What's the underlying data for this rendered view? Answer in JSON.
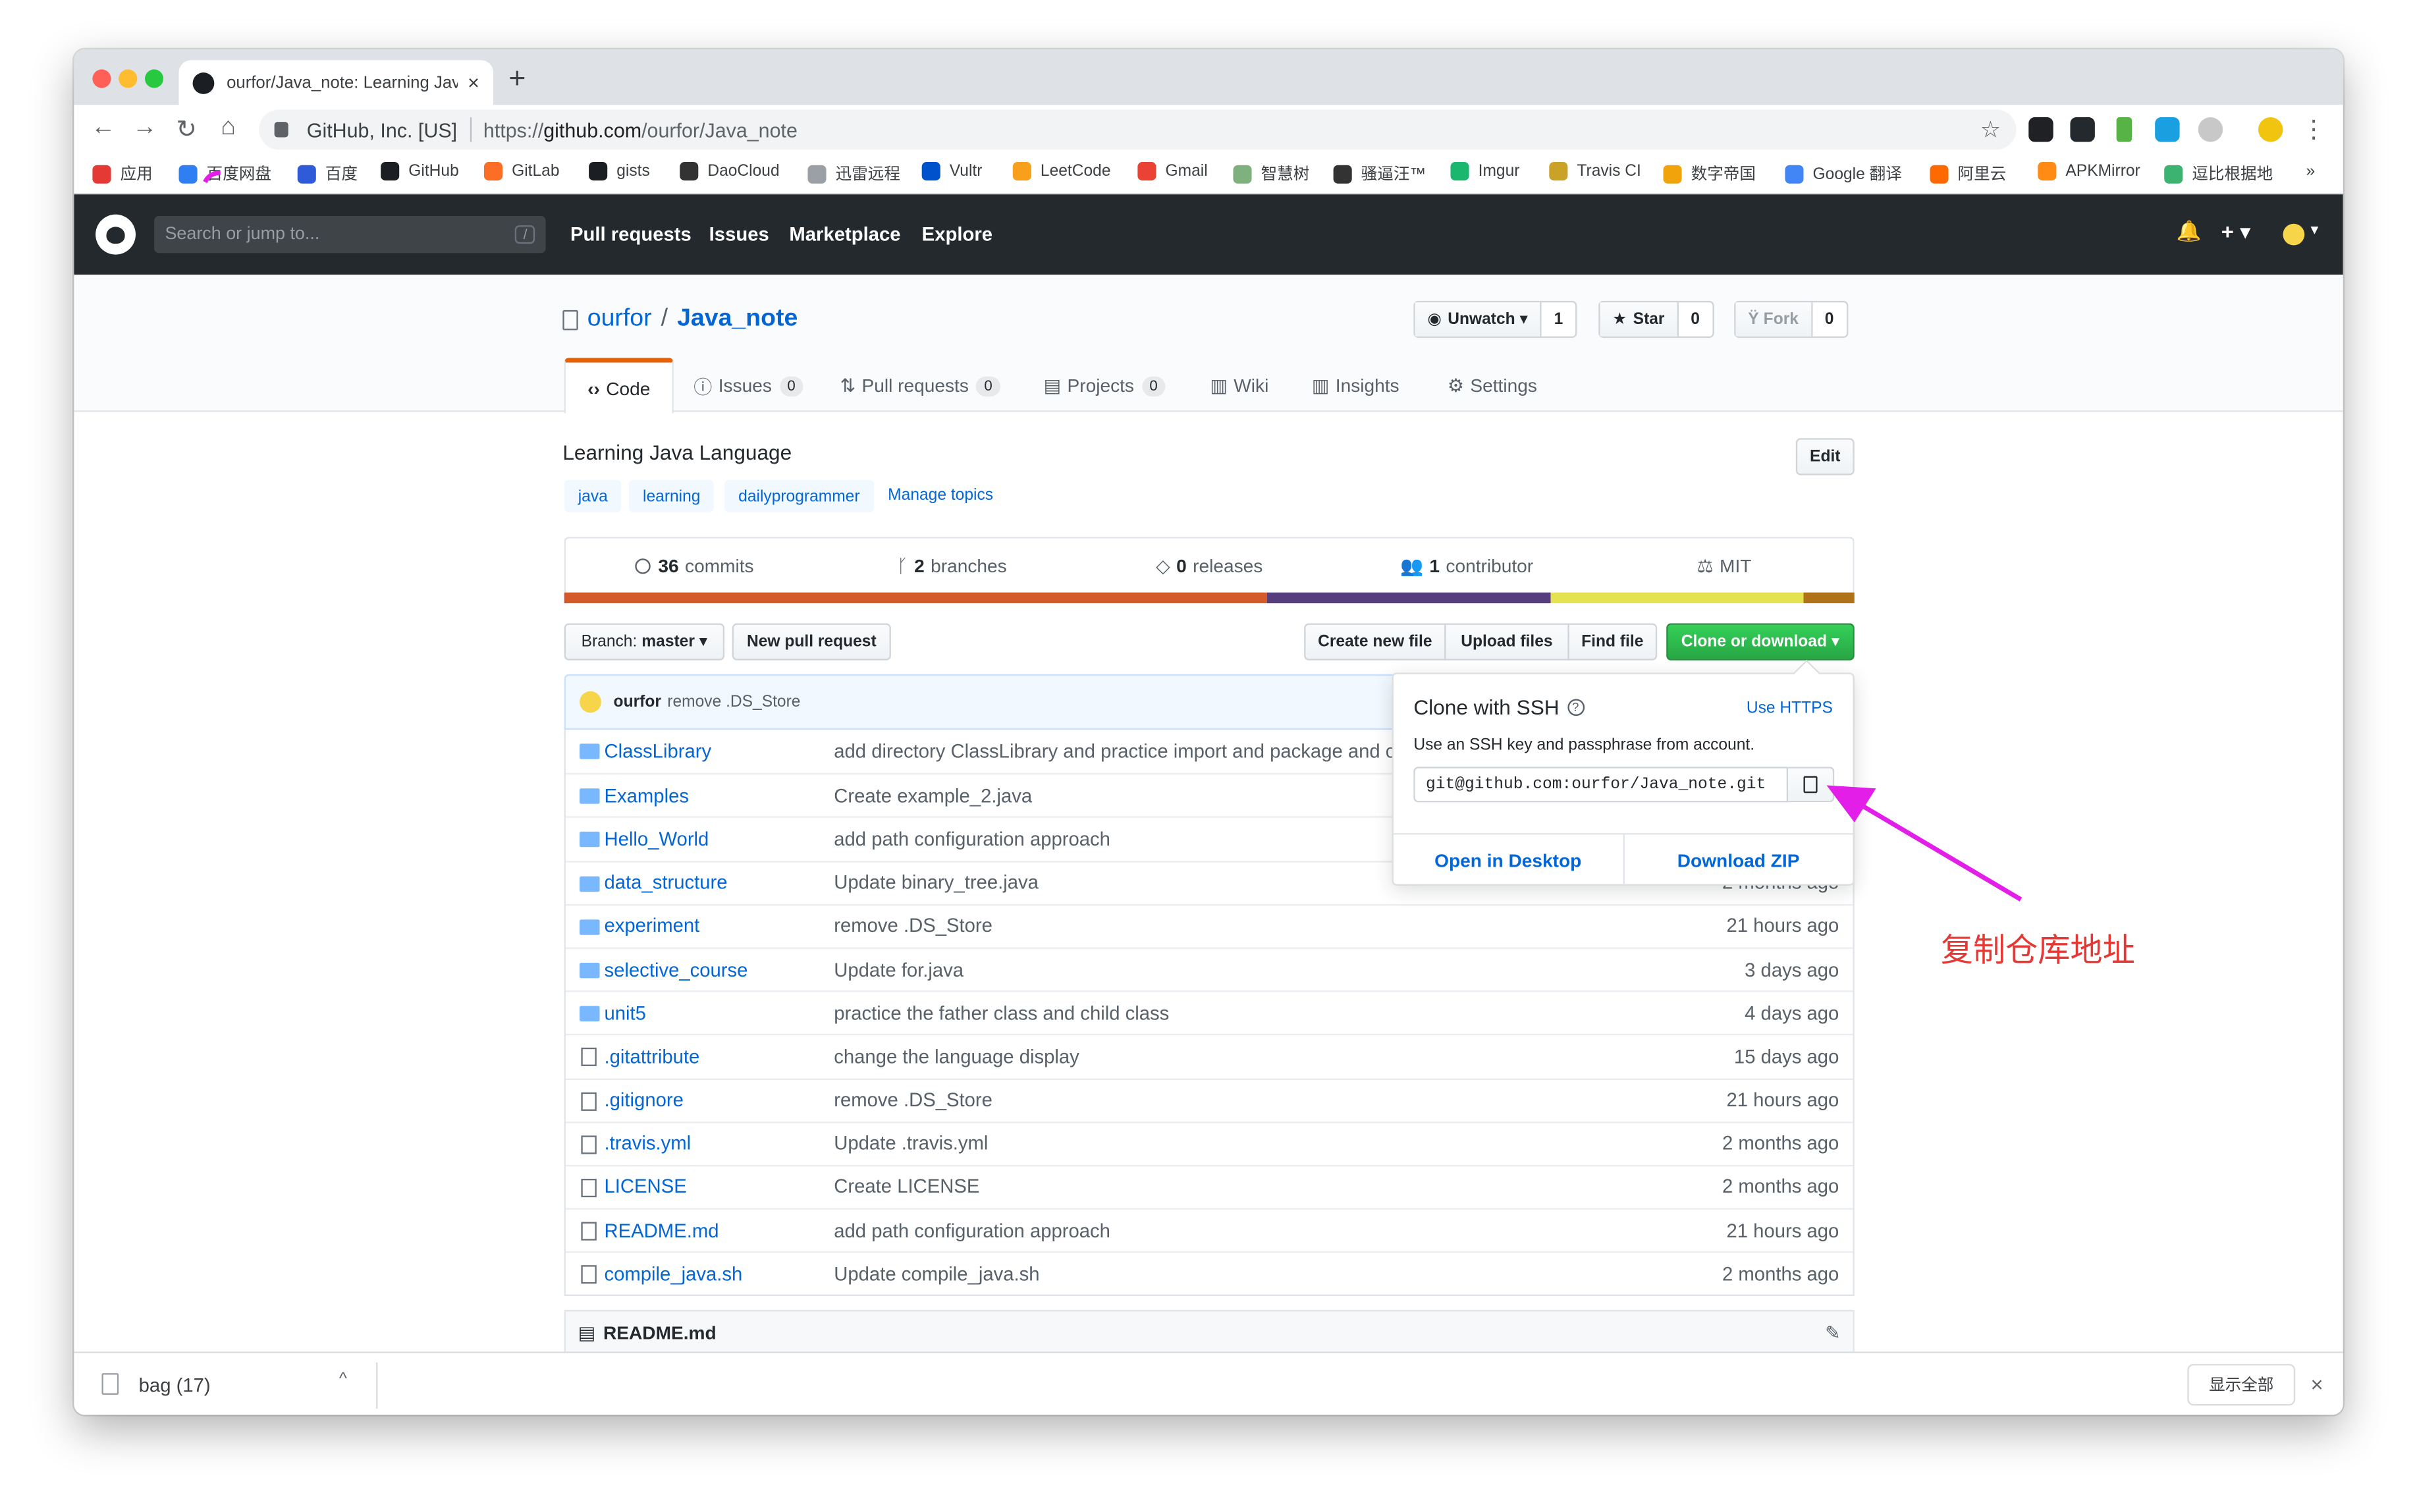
{
  "browser": {
    "tab_title": "ourfor/Java_note: Learning Jav",
    "tab_close": "×",
    "new_tab": "+",
    "url_org": "GitHub, Inc. [US]",
    "url_prefix": "https://",
    "url_host": "github.com",
    "url_path": "/ourfor/Java_note",
    "nav_back": "←",
    "nav_forward": "→",
    "nav_reload": "↻",
    "nav_home": "⌂",
    "bookmark_star": "☆",
    "menu": "⋮"
  },
  "bookmarks": [
    {
      "label": "应用",
      "icon": "apps-icon",
      "color": "#e53935"
    },
    {
      "label": "百度网盘",
      "icon": "baidu-pan-icon",
      "color": "#2f7ef2"
    },
    {
      "label": "百度",
      "icon": "baidu-icon",
      "color": "#2f5ad8"
    },
    {
      "label": "GitHub",
      "icon": "github-icon",
      "color": "#1b1f23"
    },
    {
      "label": "GitLab",
      "icon": "gitlab-icon",
      "color": "#fc6d26"
    },
    {
      "label": "gists",
      "icon": "github-icon",
      "color": "#1b1f23"
    },
    {
      "label": "DaoCloud",
      "icon": "daocloud-icon",
      "color": "#333333"
    },
    {
      "label": "迅雷远程",
      "icon": "page-icon",
      "color": "#9aa0a6"
    },
    {
      "label": "Vultr",
      "icon": "vultr-icon",
      "color": "#0052cc"
    },
    {
      "label": "LeetCode",
      "icon": "leetcode-icon",
      "color": "#f89f1b"
    },
    {
      "label": "Gmail",
      "icon": "gmail-icon",
      "color": "#ea4335"
    },
    {
      "label": "智慧树",
      "icon": "tree-icon",
      "color": "#7fb17f"
    },
    {
      "label": "骚逼汪™",
      "icon": "circle-icon",
      "color": "#333333"
    },
    {
      "label": "Imgur",
      "icon": "imgur-icon",
      "color": "#1bb76e"
    },
    {
      "label": "Travis CI",
      "icon": "travis-icon",
      "color": "#c9a227"
    },
    {
      "label": "数字帝国",
      "icon": "pi-icon",
      "color": "#f0a30a"
    },
    {
      "label": "Google 翻译",
      "icon": "translate-icon",
      "color": "#4285f4"
    },
    {
      "label": "阿里云",
      "icon": "aliyun-icon",
      "color": "#ff6a00"
    },
    {
      "label": "APKMirror",
      "icon": "apkmirror-icon",
      "color": "#ff8b14"
    },
    {
      "label": "逗比根据地",
      "icon": "leaf-icon",
      "color": "#3cb371"
    }
  ],
  "bookmarks_more": "»",
  "github": {
    "search_placeholder": "Search or jump to...",
    "search_key": "/",
    "nav": [
      "Pull requests",
      "Issues",
      "Marketplace",
      "Explore"
    ],
    "bell": "🔔",
    "plus": "+ ▾",
    "avatar_caret": "▾"
  },
  "repo": {
    "owner": "ourfor",
    "slash": "/",
    "name": "Java_note",
    "watch_label": "Unwatch ▾",
    "watch_count": "1",
    "star_label": "Star",
    "star_count": "0",
    "fork_label": "Fork",
    "fork_count": "0",
    "tabs": [
      {
        "label": "Code",
        "count": ""
      },
      {
        "label": "Issues",
        "count": "0"
      },
      {
        "label": "Pull requests",
        "count": "0"
      },
      {
        "label": "Projects",
        "count": "0"
      },
      {
        "label": "Wiki",
        "count": ""
      },
      {
        "label": "Insights",
        "count": ""
      },
      {
        "label": "Settings",
        "count": ""
      }
    ],
    "description": "Learning Java Language",
    "edit_label": "Edit",
    "topics": [
      "java",
      "learning",
      "dailyprogrammer"
    ],
    "manage_topics": "Manage topics",
    "summary": [
      {
        "num": "36",
        "label": "commits"
      },
      {
        "num": "2",
        "label": "branches"
      },
      {
        "num": "0",
        "label": "releases"
      },
      {
        "num": "1",
        "label": "contributor"
      },
      {
        "num": "",
        "label": "MIT"
      }
    ],
    "languages": [
      {
        "color": "#d35b29",
        "share": 0.545
      },
      {
        "color": "#563d7c",
        "share": 0.22
      },
      {
        "color": "#e4e24f",
        "share": 0.195
      },
      {
        "color": "#b07219",
        "share": 0.04
      }
    ]
  },
  "filenav": {
    "branch_label": "Branch:",
    "branch_name": "master ▾",
    "new_pr": "New pull request",
    "create_file": "Create new file",
    "upload": "Upload files",
    "find": "Find file",
    "clone": "Clone or download ▾"
  },
  "commit": {
    "author": "ourfor",
    "message": "remove .DS_Store"
  },
  "files": [
    {
      "type": "dir",
      "name": "ClassLibrary",
      "message": "add directory ClassLibrary and practice import and package and c",
      "age": ""
    },
    {
      "type": "dir",
      "name": "Examples",
      "message": "Create example_2.java",
      "age": ""
    },
    {
      "type": "dir",
      "name": "Hello_World",
      "message": "add path configuration approach",
      "age": ""
    },
    {
      "type": "dir",
      "name": "data_structure",
      "message": "Update binary_tree.java",
      "age": "2 months ago"
    },
    {
      "type": "dir",
      "name": "experiment",
      "message": "remove .DS_Store",
      "age": "21 hours ago"
    },
    {
      "type": "dir",
      "name": "selective_course",
      "message": "Update for.java",
      "age": "3 days ago"
    },
    {
      "type": "dir",
      "name": "unit5",
      "message": "practice the father class and child class",
      "age": "4 days ago"
    },
    {
      "type": "file",
      "name": ".gitattribute",
      "message": "change the language display",
      "age": "15 days ago"
    },
    {
      "type": "file",
      "name": ".gitignore",
      "message": "remove .DS_Store",
      "age": "21 hours ago"
    },
    {
      "type": "file",
      "name": ".travis.yml",
      "message": "Update .travis.yml",
      "age": "2 months ago"
    },
    {
      "type": "file",
      "name": "LICENSE",
      "message": "Create LICENSE",
      "age": "2 months ago"
    },
    {
      "type": "file",
      "name": "README.md",
      "message": "add path configuration approach",
      "age": "21 hours ago"
    },
    {
      "type": "file",
      "name": "compile_java.sh",
      "message": "Update compile_java.sh",
      "age": "2 months ago"
    }
  ],
  "readme": {
    "title": "README.md",
    "edit_icon": "✎"
  },
  "clone_popup": {
    "title": "Clone with SSH",
    "help": "?",
    "use_https": "Use HTTPS",
    "subtitle": "Use an SSH key and passphrase from account.",
    "url": "git@github.com:ourfor/Java_note.git",
    "open_desktop": "Open in Desktop",
    "download_zip": "Download ZIP"
  },
  "downloads": {
    "file": "bag (17)",
    "chevron": "^",
    "show_all": "显示全部",
    "close": "×"
  },
  "annotation": {
    "text": "复制仓库地址",
    "color": "#e53935",
    "arrow_color": "#e21ee8"
  }
}
